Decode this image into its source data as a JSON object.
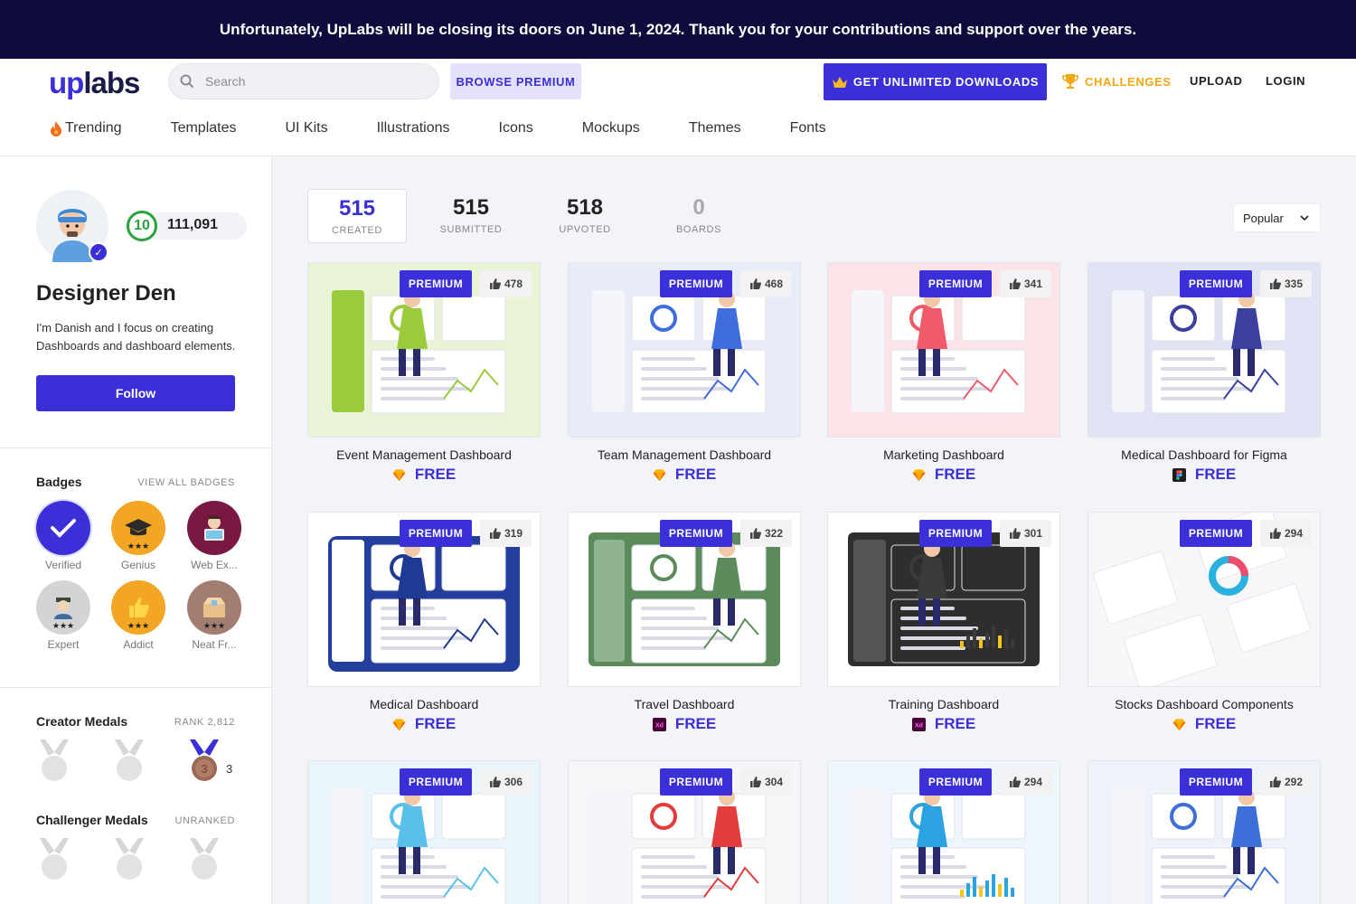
{
  "banner": {
    "text": "Unfortunately, UpLabs will be closing its doors on June 1, 2024. Thank you for your contributions and support over the years."
  },
  "header": {
    "logo_up": "up",
    "logo_labs": "labs",
    "search_placeholder": "Search",
    "browse_premium": "BROWSE PREMIUM",
    "unlimited": "GET UNLIMITED DOWNLOADS",
    "challenges": "CHALLENGES",
    "upload": "UPLOAD",
    "login": "LOGIN"
  },
  "categories": [
    "Trending",
    "Templates",
    "UI Kits",
    "Illustrations",
    "Icons",
    "Mockups",
    "Themes",
    "Fonts"
  ],
  "profile": {
    "level": "10",
    "points": "111,091",
    "name": "Designer Den",
    "bio": "I'm Danish and I focus on creating Dashboards and dashboard elements.",
    "follow": "Follow"
  },
  "badges": {
    "title": "Badges",
    "link": "VIEW ALL BADGES",
    "items": [
      {
        "label": "Verified",
        "icon": "check-icon",
        "color": "#3b2fd8",
        "stars": ""
      },
      {
        "label": "Genius",
        "icon": "graduation-cap-icon",
        "color": "#f2a623",
        "stars": "★★★"
      },
      {
        "label": "Web Ex...",
        "icon": "developer-icon",
        "color": "#7a1742",
        "stars": ""
      },
      {
        "label": "Expert",
        "icon": "expert-icon",
        "color": "#c9c9c9",
        "stars": "★★★"
      },
      {
        "label": "Addict",
        "icon": "thumbs-up-icon",
        "color": "#f2a623",
        "stars": "★★★"
      },
      {
        "label": "Neat Fr...",
        "icon": "box-icon",
        "color": "#a17d72",
        "stars": "★★★"
      }
    ]
  },
  "creator_medals": {
    "title": "Creator Medals",
    "rank": "RANK 2,812",
    "bronze_count": "3"
  },
  "challenger_medals": {
    "title": "Challenger Medals",
    "rank": "UNRANKED"
  },
  "stats": [
    {
      "num": "515",
      "label": "CREATED"
    },
    {
      "num": "515",
      "label": "SUBMITTED"
    },
    {
      "num": "518",
      "label": "UPVOTED"
    },
    {
      "num": "0",
      "label": "BOARDS"
    }
  ],
  "sort": "Popular",
  "premium_label": "PREMIUM",
  "free_label": "FREE",
  "cards": [
    {
      "title": "Event Management Dashboard",
      "likes": "478",
      "tool": "sketch",
      "bg": "#e9f4d7",
      "accent": "#9bcb3c"
    },
    {
      "title": "Team Management Dashboard",
      "likes": "468",
      "tool": "sketch",
      "bg": "#e7ecf8",
      "accent": "#3f6de0"
    },
    {
      "title": "Marketing Dashboard",
      "likes": "341",
      "tool": "sketch",
      "bg": "#fbe4e7",
      "accent": "#ef5b6a"
    },
    {
      "title": "Medical Dashboard for Figma",
      "likes": "335",
      "tool": "figma",
      "bg": "#dfe3f3",
      "accent": "#3c3f9e"
    },
    {
      "title": "Medical Dashboard",
      "likes": "319",
      "tool": "sketch",
      "bg": "#ffffff",
      "accent": "#1f3a93"
    },
    {
      "title": "Travel Dashboard",
      "likes": "322",
      "tool": "xd",
      "bg": "#ffffff",
      "accent": "#5b8a5b"
    },
    {
      "title": "Training Dashboard",
      "likes": "301",
      "tool": "xd",
      "bg": "#ffffff",
      "accent": "#3a3a3a"
    },
    {
      "title": "Stocks Dashboard Components",
      "likes": "294",
      "tool": "sketch",
      "bg": "#f7f7fa",
      "accent": "#2bb1e0"
    },
    {
      "title": "",
      "likes": "306",
      "tool": "",
      "bg": "#eaf5fb",
      "accent": "#59c0e8"
    },
    {
      "title": "",
      "likes": "304",
      "tool": "",
      "bg": "#f6f6f8",
      "accent": "#e43b3b"
    },
    {
      "title": "",
      "likes": "294",
      "tool": "",
      "bg": "#eef6fb",
      "accent": "#2aa3e0"
    },
    {
      "title": "",
      "likes": "292",
      "tool": "",
      "bg": "#eef3f9",
      "accent": "#3d6fd8"
    }
  ]
}
